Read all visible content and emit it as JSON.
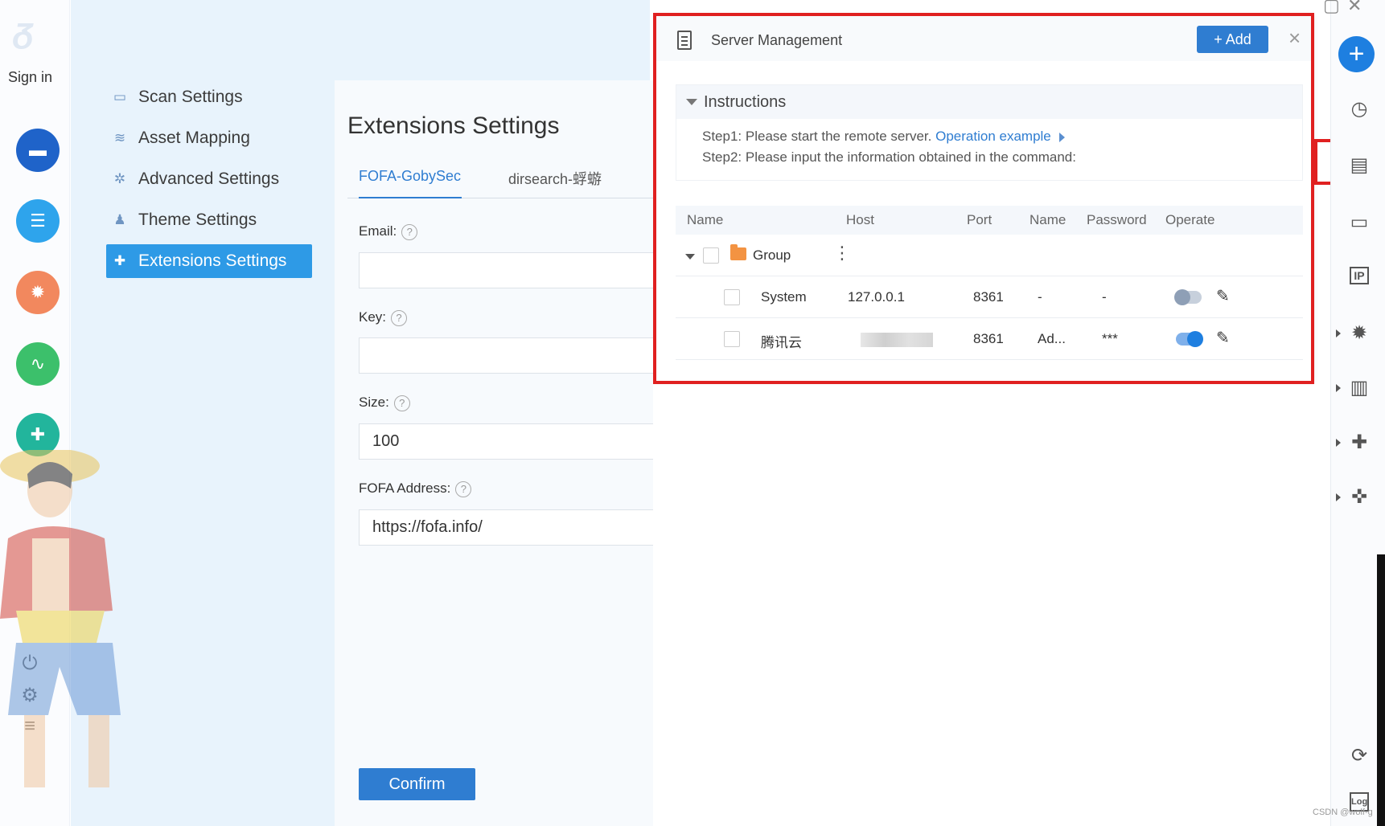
{
  "rail": {
    "sign_in": "Sign in"
  },
  "settings_nav": {
    "items": [
      {
        "label": "Scan Settings",
        "icon": "monitor-icon"
      },
      {
        "label": "Asset Mapping",
        "icon": "layers-icon"
      },
      {
        "label": "Advanced Settings",
        "icon": "cog-icon"
      },
      {
        "label": "Theme Settings",
        "icon": "shirt-icon"
      },
      {
        "label": "Extensions Settings",
        "icon": "puzzle-icon",
        "active": true
      }
    ]
  },
  "extensions": {
    "title": "Extensions Settings",
    "tabs": [
      "FOFA-GobySec",
      "dirsearch-蜉蝣"
    ],
    "active_tab": "FOFA-GobySec",
    "fields": {
      "email": {
        "label": "Email:",
        "value": ""
      },
      "key": {
        "label": "Key:",
        "value": ""
      },
      "size": {
        "label": "Size:",
        "value": "100"
      },
      "fofa_address": {
        "label": "FOFA Address:",
        "value": "https://fofa.info/"
      }
    },
    "help_glyph": "?",
    "confirm_label": "Confirm"
  },
  "server_management": {
    "title": "Server Management",
    "add_label": "+ Add",
    "close_glyph": "×",
    "instructions": {
      "heading": "Instructions",
      "step1_prefix": "Step1:",
      "step1_text": "Please start the remote server.",
      "step1_link": "Operation example",
      "step2_prefix": "Step2:",
      "step2_text": "Please input the information obtained in the command:"
    },
    "columns": [
      "Name",
      "Host",
      "Port",
      "Name",
      "Password",
      "Operate"
    ],
    "group": {
      "label": "Group",
      "menu_glyph": "⋮"
    },
    "rows": [
      {
        "name": "System",
        "host": "127.0.0.1",
        "port": "8361",
        "user": "-",
        "password": "-",
        "enabled": false
      },
      {
        "name": "腾讯云",
        "host": "",
        "port": "8361",
        "user": "Ad...",
        "password": "***",
        "enabled": true
      }
    ],
    "edit_glyph": "✎"
  },
  "right_toolbar": {
    "plus_glyph": "+",
    "icons": [
      "history-icon",
      "server-icon",
      "monitor-icon",
      "ip-icon",
      "bug-icon",
      "chart-icon",
      "plugin-icon",
      "plugin-run-icon",
      "refresh-icon",
      "log-icon"
    ],
    "ip_text": "IP",
    "log_text": "Log"
  },
  "watermark": "CSDN @wolf-g",
  "colors": {
    "accent": "#2f7dd1",
    "highlight_red": "#e02020",
    "folder_orange": "#f39342"
  }
}
